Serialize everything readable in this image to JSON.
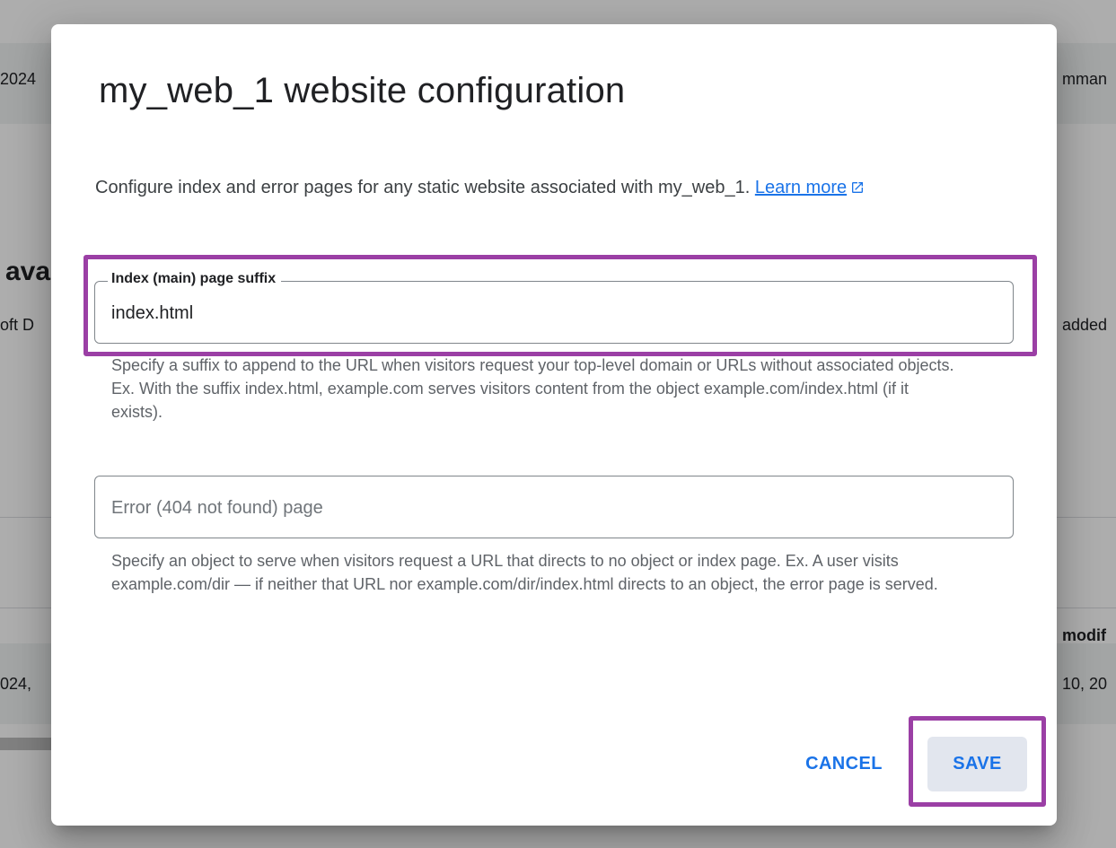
{
  "background": {
    "fragments": [
      "2024",
      "mman",
      "ava",
      "oft D",
      "added",
      "modif",
      "024,",
      "10, 20"
    ]
  },
  "dialog": {
    "title": "my_web_1 website configuration",
    "description": "Configure index and error pages for any static website associated with my_web_1.",
    "learn_more": "Learn more",
    "index_field": {
      "label": "Index (main) page suffix",
      "value": "index.html",
      "helper": "Specify a suffix to append to the URL when visitors request your top-level domain or URLs without associated objects. Ex. With the suffix index.html, example.com serves visitors content from the object example.com/index.html (if it exists)."
    },
    "error_field": {
      "placeholder": "Error (404 not found) page",
      "value": "",
      "helper": "Specify an object to serve when visitors request a URL that directs to no object or index page. Ex. A user visits example.com/dir — if neither that URL nor example.com/dir/index.html directs to an object, the error page is served."
    },
    "buttons": {
      "cancel": "CANCEL",
      "save": "SAVE"
    }
  },
  "colors": {
    "accent": "#1a73e8",
    "highlight": "#9b3fa5",
    "save_bg": "#e2e6ee"
  },
  "icons": [
    "external-link-icon"
  ]
}
